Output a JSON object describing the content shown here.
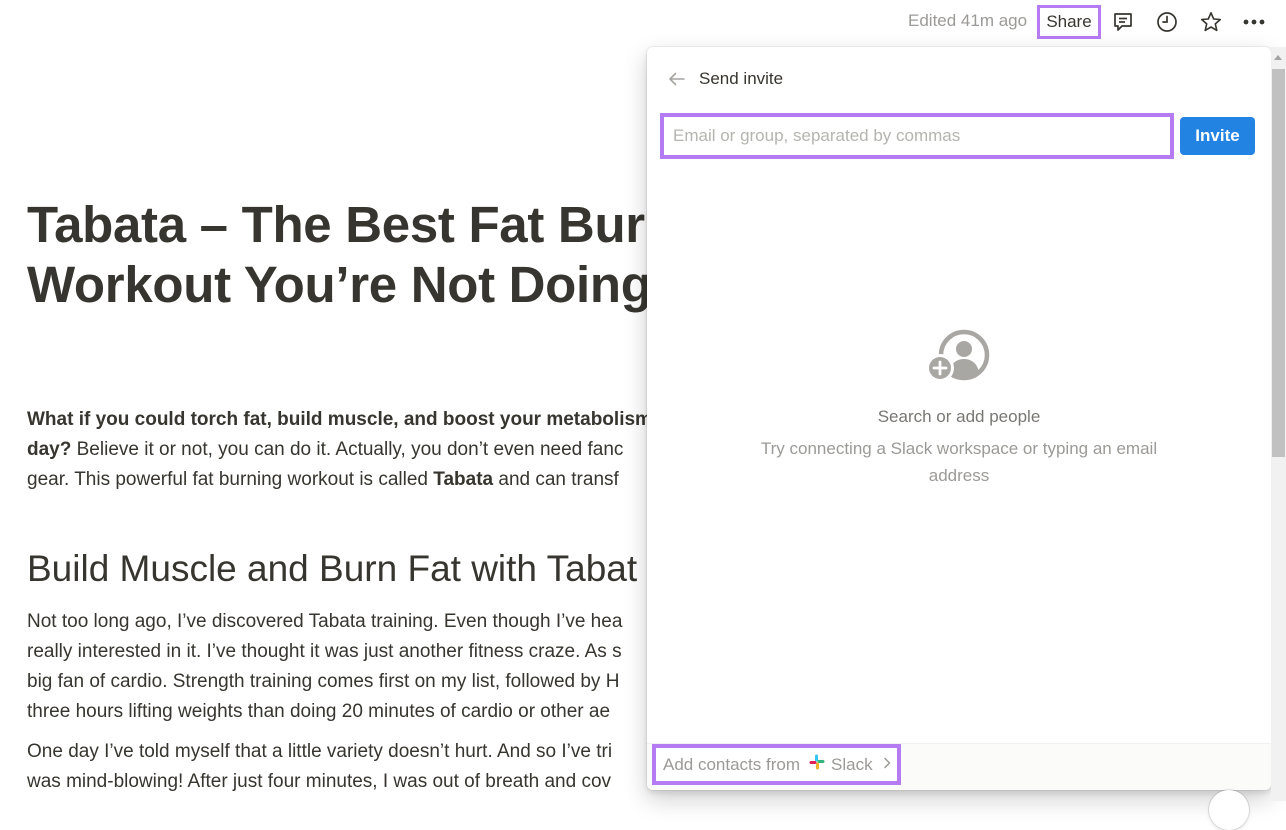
{
  "topbar": {
    "edited_label": "Edited 41m ago",
    "share_label": "Share",
    "icons": [
      "comment-icon",
      "clock-history-icon",
      "star-icon",
      "more-icon"
    ]
  },
  "document": {
    "title_line1": "Tabata – The Best Fat Burn",
    "title_line2": "Workout You’re Not Doing",
    "intro": {
      "line1_bold": "What if you could torch fat, build muscle, and boost your metabolism",
      "line2_bold": "day?",
      "line2_rest": " Believe it or not, you can do it. Actually, you don’t even need fanc",
      "line3_pre": "gear. This powerful fat burning workout is called ",
      "line3_bold": "Tabata",
      "line3_post": " and can transf"
    },
    "heading2": "Build Muscle and Burn Fat with Tabat",
    "para2": [
      "Not too long ago, I’ve discovered Tabata training. Even though I’ve hea",
      "really interested in it. I’ve thought it was just another fitness craze. As s",
      "big fan of cardio. Strength training comes first on my list, followed by H",
      "three hours lifting weights than doing 20 minutes of cardio or other ae"
    ],
    "para3": [
      "One day I’ve told myself that a little variety doesn’t hurt. And so I’ve tri",
      "was mind-blowing! After just four minutes, I was out of breath and cov"
    ]
  },
  "share_panel": {
    "title": "Send invite",
    "email_placeholder": "Email or group, separated by commas",
    "email_value": "",
    "invite_label": "Invite",
    "empty_title": "Search or add people",
    "empty_subtitle": "Try connecting a Slack workspace or typing an email address",
    "footer": {
      "add_contacts_label": "Add contacts from",
      "provider": "Slack"
    }
  },
  "colors": {
    "highlight": "#b57bf3",
    "invite_button": "#2383e2",
    "text": "#37352f",
    "muted_text": "#9b9a97"
  }
}
